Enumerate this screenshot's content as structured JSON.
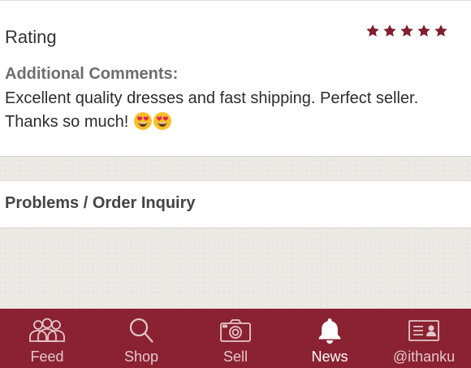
{
  "rating": {
    "label": "Rating",
    "stars": 5,
    "max_stars": 5,
    "star_color": "#7e1e2e"
  },
  "comments": {
    "title": "Additional Comments:",
    "text": "Excellent quality dresses and fast shipping. Perfect seller. Thanks so much!",
    "emojis": [
      "heart-eyes-emoji",
      "heart-eyes-emoji"
    ]
  },
  "problems": {
    "label": "Problems / Order Inquiry"
  },
  "tabbar": {
    "background": "#8a2231",
    "active_tab": "News",
    "tabs": [
      {
        "label": "Feed",
        "icon": "people-icon"
      },
      {
        "label": "Shop",
        "icon": "search-icon"
      },
      {
        "label": "Sell",
        "icon": "camera-icon"
      },
      {
        "label": "News",
        "icon": "bell-icon"
      },
      {
        "label": "@ithanku",
        "icon": "profile-card-icon"
      }
    ]
  }
}
